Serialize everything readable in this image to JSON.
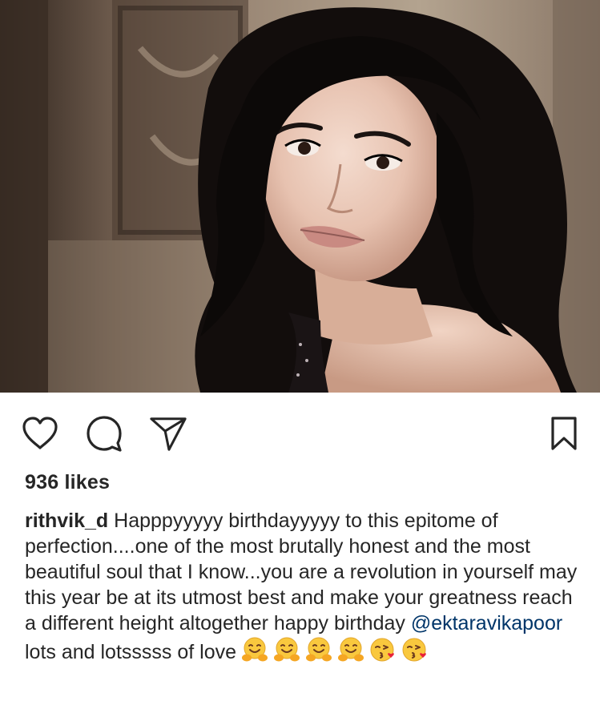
{
  "post": {
    "photo_subject": "portrait-photo",
    "likes_text": "936 likes",
    "username": "rithvik_d",
    "caption_text_1": " Happpyyyyy birthdayyyyy to this epitome of perfection....one of the most brutally honest and the most beautiful soul that I know...you are a revolution in yourself may this year be at its utmost best and make your greatness reach a different height altogether happy birthday ",
    "mention": "@ektaravikapoor",
    "caption_text_2": " lots and lotsssss of love",
    "emojis": [
      "hugging-face-icon",
      "hugging-face-icon",
      "hugging-face-icon",
      "hugging-face-icon",
      "face-blowing-kiss-icon",
      "face-blowing-kiss-icon"
    ]
  },
  "actions": {
    "like": "heart-icon",
    "comment": "comment-bubble-icon",
    "share": "paper-plane-icon",
    "save": "bookmark-icon"
  },
  "colors": {
    "text": "#262626",
    "mention": "#003569",
    "background": "#ffffff"
  }
}
